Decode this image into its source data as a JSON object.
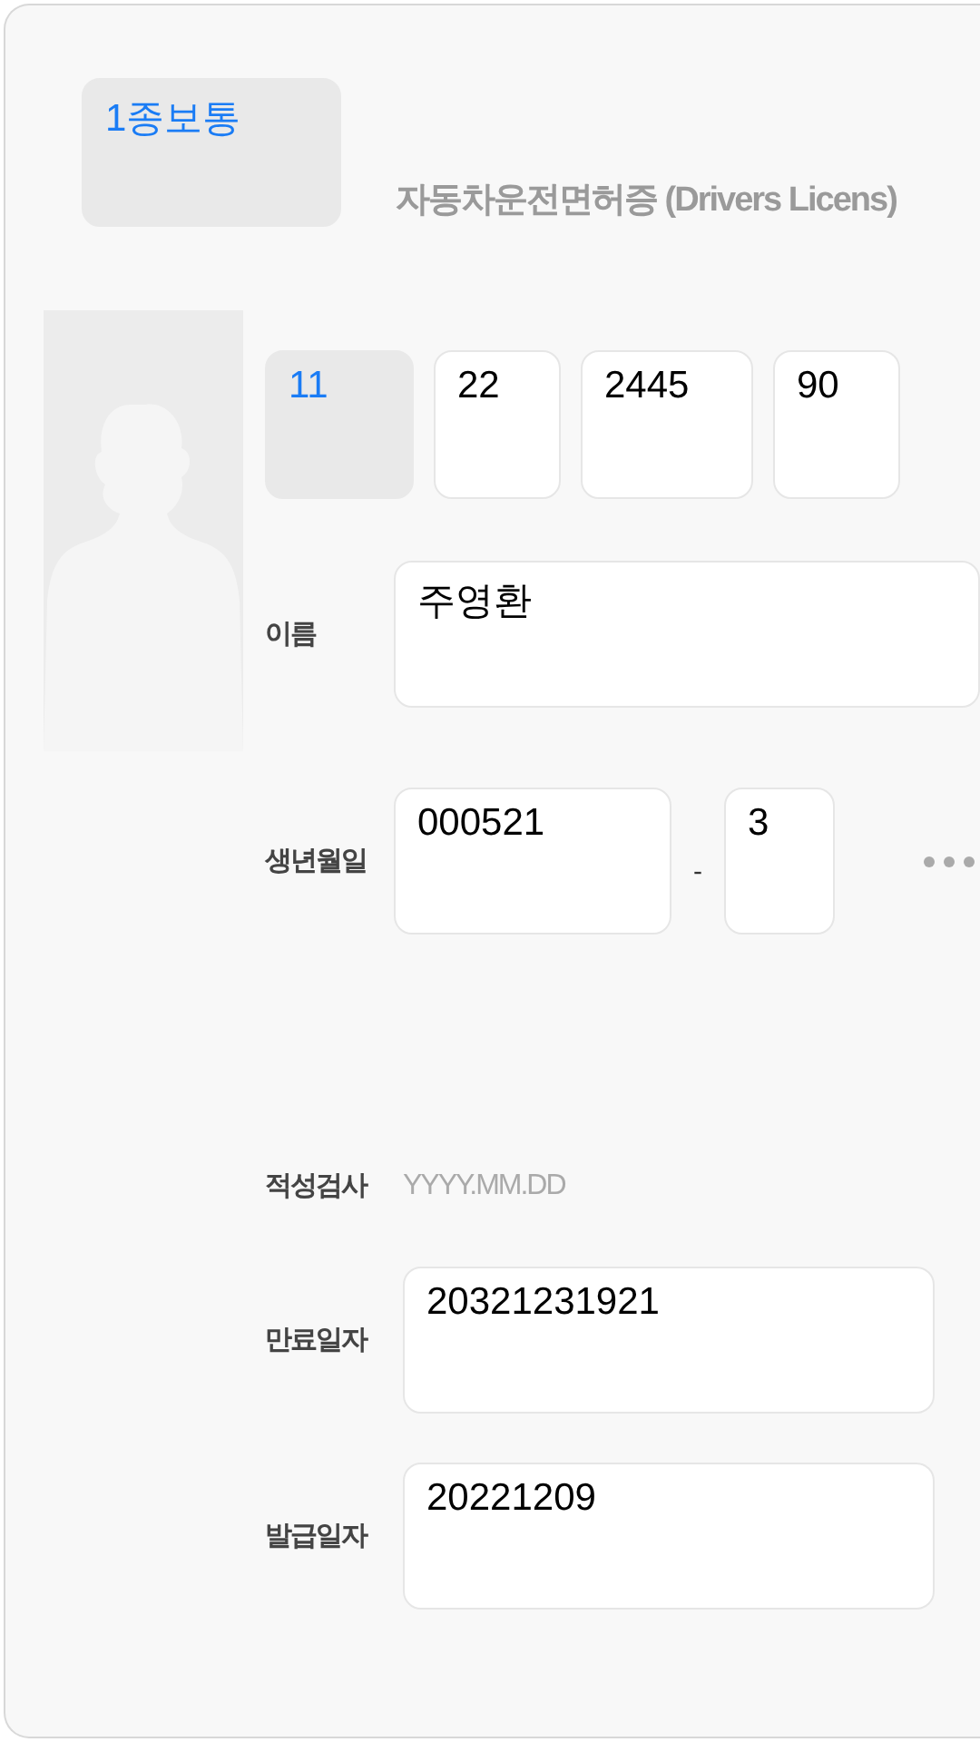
{
  "license_type": {
    "value": "1종보통",
    "readonly": true
  },
  "title": "자동차운전면허증 (Drivers Licens)",
  "license_number": [
    {
      "value": "11",
      "readonly": true
    },
    {
      "value": "22",
      "readonly": false
    },
    {
      "value": "2445",
      "readonly": false
    },
    {
      "value": "90",
      "readonly": false
    }
  ],
  "name": {
    "label": "이름",
    "value": "주영환"
  },
  "birth": {
    "label": "생년월일",
    "value": "000521",
    "separator": "-",
    "gender_digit": "3"
  },
  "aptitude_test": {
    "label": "적성검사",
    "placeholder": "YYYY.MM.DD"
  },
  "expiry": {
    "label": "만료일자",
    "value": "20321231921"
  },
  "issue": {
    "label": "발급일자",
    "value": "20221209"
  }
}
